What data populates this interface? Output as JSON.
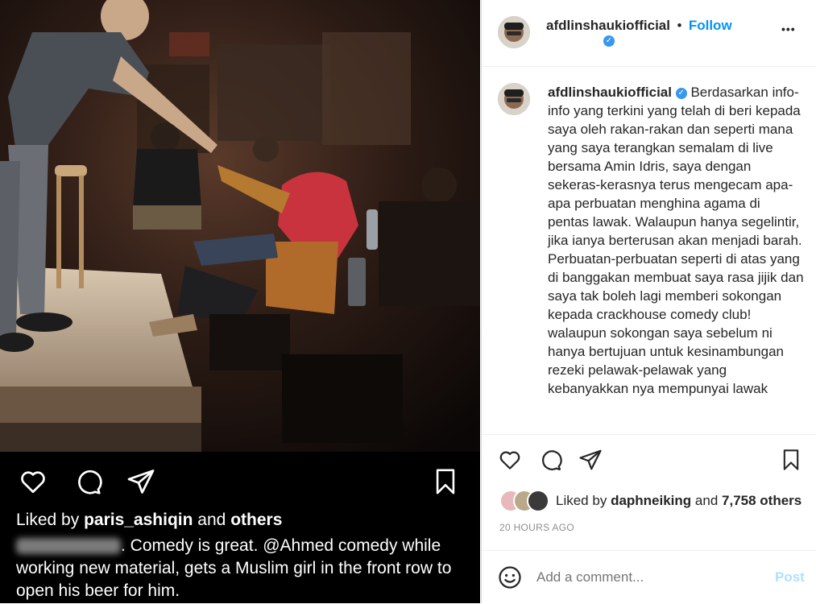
{
  "post": {
    "username": "afdlinshaukiofficial",
    "follow_label": "Follow",
    "separator": "•",
    "more_label": "•••",
    "caption": "Berdasarkan info-info yang terkini yang telah di beri kepada saya oleh rakan-rakan dan seperti mana yang saya terangkan semalam di live bersama Amin Idris, saya dengan sekeras-kerasnya terus mengecam apa-apa perbuatan menghina agama di pentas lawak. Walaupun hanya segelintir, jika ianya berterusan akan menjadi barah. Perbuatan-perbuatan seperti di atas yang di banggakan membuat saya rasa jijik dan saya tak boleh lagi memberi sokongan kepada crackhouse comedy club! walaupun sokongan saya sebelum ni hanya bertujuan untuk kesinambungan rezeki pelawak-pelawak yang kebanyakkan nya mempunyai lawak",
    "liked_by_prefix": "Liked by",
    "liked_by_user": "daphneiking",
    "liked_by_and": "and",
    "liked_by_count": "7,758 others",
    "timestamp": "20 HOURS AGO",
    "comment_placeholder": "Add a comment...",
    "post_label": "Post"
  },
  "embedded": {
    "liked_by_prefix": "Liked by",
    "liked_by_user": "paris_ashiqin",
    "liked_by_and": "and",
    "liked_by_others": "others",
    "caption_line1": ". Comedy is great. @Ahmed comedy while",
    "caption_line2": "working new material, gets a Muslim girl in the front row to",
    "caption_line3": "open his beer for him."
  },
  "colors": {
    "accent_blue": "#0095f6",
    "verified_blue": "#3897f0",
    "muted": "#8e8e8e"
  }
}
